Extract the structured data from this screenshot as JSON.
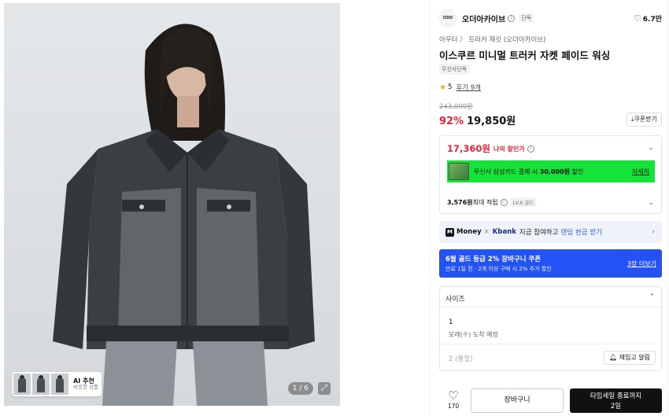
{
  "gallery": {
    "ai_title": "AI 추천",
    "ai_sub": "비슷한 상품",
    "counter": "1 / 6",
    "expand_icon": "expand-icon"
  },
  "brand": {
    "logo_text": "ODD",
    "name": "오더아카이브",
    "info": "i",
    "badge": "단독",
    "likes": "6.7만"
  },
  "breadcrumb": "아우터 〉 트러커 재킷 (오더아카이브)",
  "title": "이스쿠르 미니멀 트러커 자켓 페이드 워싱",
  "exclusive_badge": "무신사단독",
  "rating": {
    "score": "5",
    "reviews": "후기 9개"
  },
  "price": {
    "original": "243,000원",
    "discount": "92%",
    "sale": "19,850원",
    "coupon_button": "⤓쿠폰받기"
  },
  "benefits": {
    "my_price": "17,360원",
    "my_price_label": "나의 할인가",
    "card_text_pre": "무신사 삼성카드 결제 시 ",
    "card_text_bold": "30,000원",
    "card_text_post": " 할인",
    "card_link": "자세히",
    "points_bold": "3,576원",
    "points_text": " 최대 적립",
    "level": "LV.6 골드"
  },
  "money_bar": {
    "logo": "M",
    "money": "Money",
    "x": "×",
    "kbank": "Kbank",
    "desc": "지금 참여하고",
    "link": "랜덤 현금 받기"
  },
  "blue_coupon": {
    "title": "6월 골드 등급 2% 장바구니 쿠폰",
    "sub": "만료 1일 전 · 2개 이상 구매 시 2% 추가 할인",
    "more": "3장 더보기"
  },
  "size": {
    "header": "사이즈",
    "option1": "1",
    "option1_sub": "모레(수) 도착 예정",
    "option2": "2 (품절)",
    "restock": "재입고 알림"
  },
  "bottom": {
    "like_count": "170",
    "cart": "장바구니",
    "buy_line1": "타임세일 종료까지",
    "buy_line2": "2일"
  },
  "colors": {
    "accent_red": "#e8223a",
    "card_green": "#15e33a",
    "coupon_blue": "#2453f5"
  }
}
